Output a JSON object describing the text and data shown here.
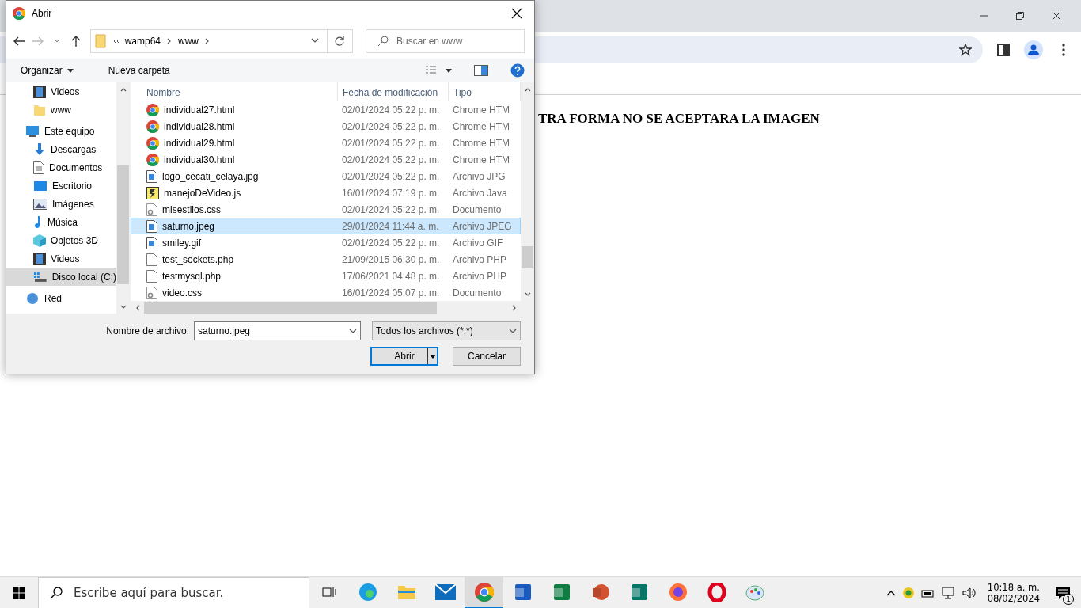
{
  "browser": {
    "heading": "TRA FORMA NO SE ACEPTARA LA IMAGEN"
  },
  "dialog": {
    "title": "Abrir",
    "path": [
      "wamp64",
      "www"
    ],
    "search": {
      "placeholder": "Buscar en www"
    },
    "commands": [
      "Organizar",
      "Nueva carpeta"
    ],
    "sidebar": {
      "quick_access": [
        {
          "label": "Videos",
          "kind": "video",
          "selected": false
        },
        {
          "label": "www",
          "kind": "folder",
          "selected": false
        }
      ],
      "tree": [
        {
          "label": "Este equipo",
          "kind": "pc",
          "selected": false,
          "children": [
            {
              "label": "Descargas",
              "kind": "download",
              "selected": false
            },
            {
              "label": "Documentos",
              "kind": "document",
              "selected": false
            },
            {
              "label": "Escritorio",
              "kind": "desktop",
              "selected": false
            },
            {
              "label": "Imágenes",
              "kind": "pictures",
              "selected": false
            },
            {
              "label": "Música",
              "kind": "music",
              "selected": false
            },
            {
              "label": "Objetos 3D",
              "kind": "cube",
              "selected": false
            },
            {
              "label": "Videos",
              "kind": "video",
              "selected": false
            },
            {
              "label": "Disco local (C:)",
              "kind": "drive",
              "selected": true
            }
          ]
        },
        {
          "label": "Red",
          "kind": "network",
          "selected": false
        }
      ]
    },
    "columns": [
      "Nombre",
      "Fecha de modificación",
      "Tipo"
    ],
    "files": [
      {
        "name": "individual27.html",
        "modified": "02/01/2024 05:22 p. m.",
        "type": "Chrome HTM",
        "kind": "chrome",
        "selected": false
      },
      {
        "name": "individual28.html",
        "modified": "02/01/2024 05:22 p. m.",
        "type": "Chrome HTM",
        "kind": "chrome",
        "selected": false
      },
      {
        "name": "individual29.html",
        "modified": "02/01/2024 05:22 p. m.",
        "type": "Chrome HTM",
        "kind": "chrome",
        "selected": false
      },
      {
        "name": "individual30.html",
        "modified": "02/01/2024 05:22 p. m.",
        "type": "Chrome HTM",
        "kind": "chrome",
        "selected": false
      },
      {
        "name": "logo_cecati_celaya.jpg",
        "modified": "02/01/2024 05:22 p. m.",
        "type": "Archivo JPG",
        "kind": "image",
        "selected": false
      },
      {
        "name": "manejoDeVideo.js",
        "modified": "16/01/2024 07:19 p. m.",
        "type": "Archivo Java",
        "kind": "script",
        "selected": false
      },
      {
        "name": "misestilos.css",
        "modified": "02/01/2024 05:22 p. m.",
        "type": "Documento",
        "kind": "css",
        "selected": false
      },
      {
        "name": "saturno.jpeg",
        "modified": "29/01/2024 11:44 a. m.",
        "type": "Archivo JPEG",
        "kind": "image",
        "selected": true
      },
      {
        "name": "smiley.gif",
        "modified": "02/01/2024 05:22 p. m.",
        "type": "Archivo GIF",
        "kind": "image",
        "selected": false
      },
      {
        "name": "test_sockets.php",
        "modified": "21/09/2015 06:30 p. m.",
        "type": "Archivo PHP",
        "kind": "blank",
        "selected": false
      },
      {
        "name": "testmysql.php",
        "modified": "17/06/2021 04:48 p. m.",
        "type": "Archivo PHP",
        "kind": "blank",
        "selected": false
      },
      {
        "name": "video.css",
        "modified": "16/01/2024 05:07 p. m.",
        "type": "Documento",
        "kind": "css",
        "selected": false
      }
    ],
    "filename": {
      "label": "Nombre de archivo:",
      "value": "saturno.jpeg"
    },
    "filter": "Todos los archivos (*.*)",
    "buttons": [
      {
        "label": "Abrir",
        "kind": "split"
      },
      {
        "label": "Cancelar",
        "kind": "plain"
      }
    ]
  },
  "taskbar": {
    "search": {
      "placeholder": "Escribe aquí para buscar."
    },
    "apps": [
      {
        "kind": "edge",
        "selected": false
      },
      {
        "kind": "explorer",
        "selected": false
      },
      {
        "kind": "mail",
        "selected": false
      },
      {
        "kind": "chrome",
        "selected": true
      },
      {
        "kind": "word",
        "selected": false
      },
      {
        "kind": "excel",
        "selected": false
      },
      {
        "kind": "powerpoint",
        "selected": false
      },
      {
        "kind": "publisher",
        "selected": false
      },
      {
        "kind": "firefox",
        "selected": false
      },
      {
        "kind": "opera",
        "selected": false
      },
      {
        "kind": "paint",
        "selected": false
      }
    ],
    "time": "10:18 a. m.",
    "date": "08/02/2024",
    "notifications": "1"
  }
}
